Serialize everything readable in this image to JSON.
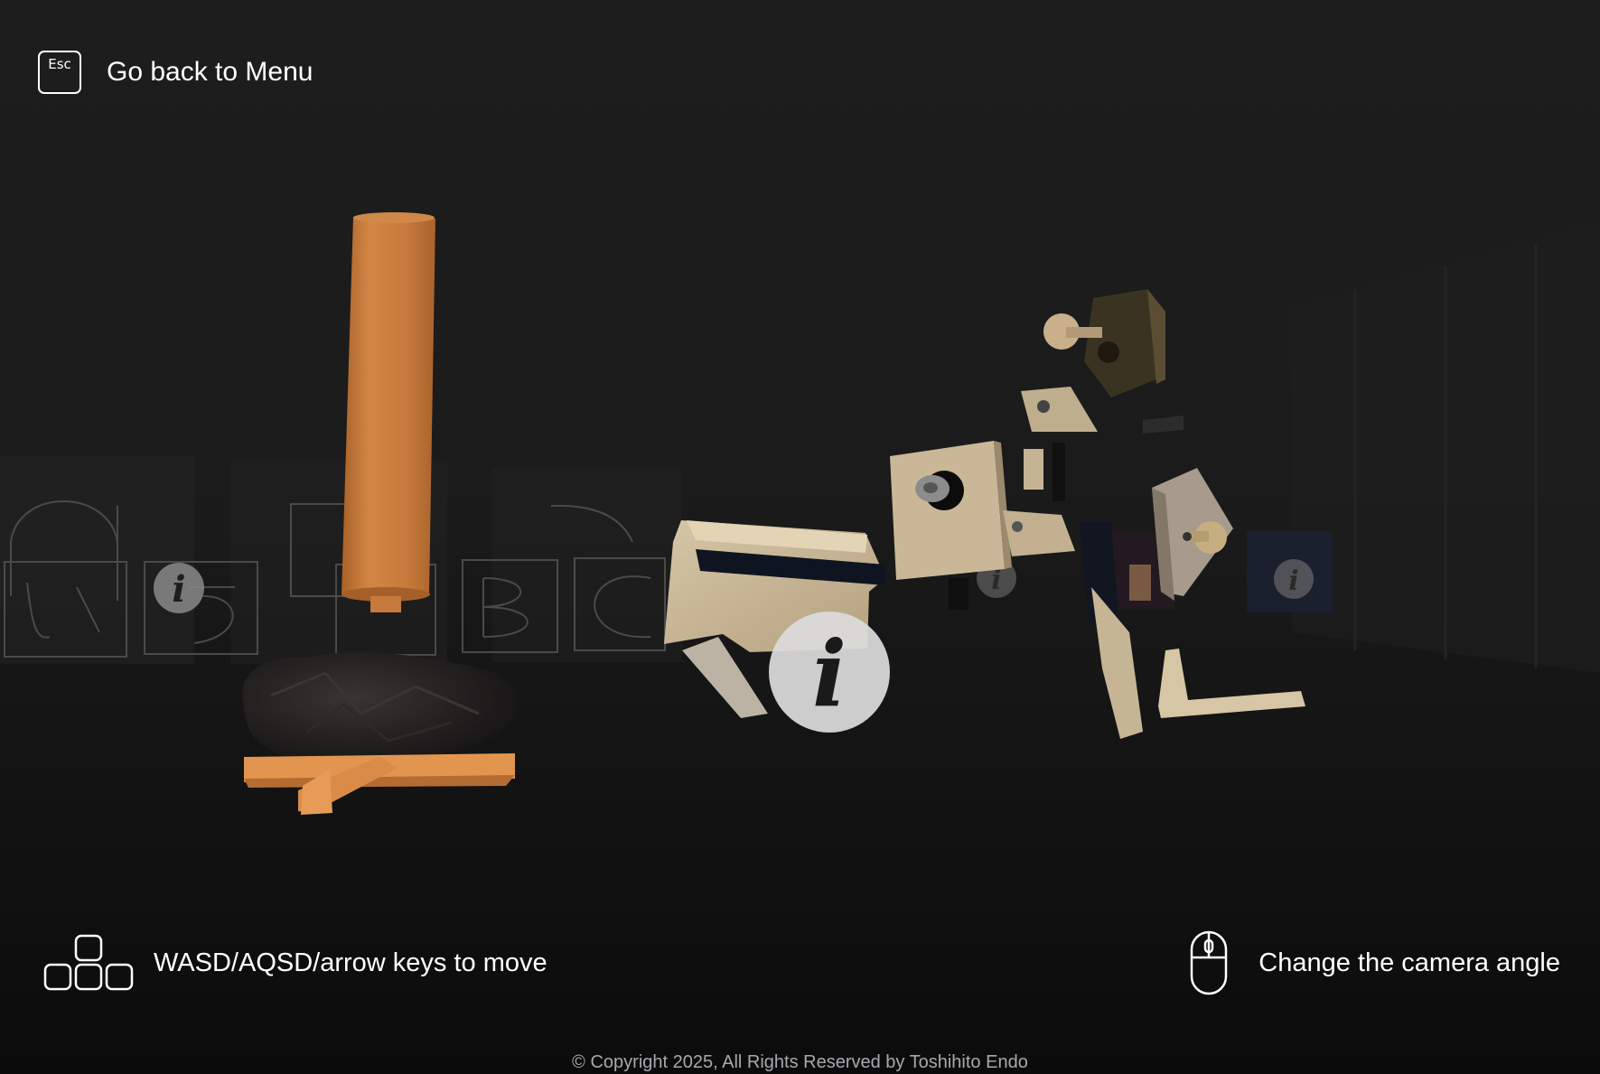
{
  "hud": {
    "back": {
      "key_label": "Esc",
      "label": "Go back to Menu"
    },
    "move": {
      "icon": "keyboard-keys-icon",
      "label": "WASD/AQSD/arrow keys to move"
    },
    "camera": {
      "icon": "mouse-icon",
      "label": "Change the camera angle"
    }
  },
  "info_marker_glyph": "i",
  "footer": {
    "copyright": "© Copyright 2025, All Rights Reserved by Toshihito Endo"
  },
  "colors": {
    "background": "#1b1b1b",
    "text": "#ffffff",
    "footer_text": "#a7a9ae",
    "orange_model": "#c77a3c",
    "beige_model": "#c9b797"
  }
}
